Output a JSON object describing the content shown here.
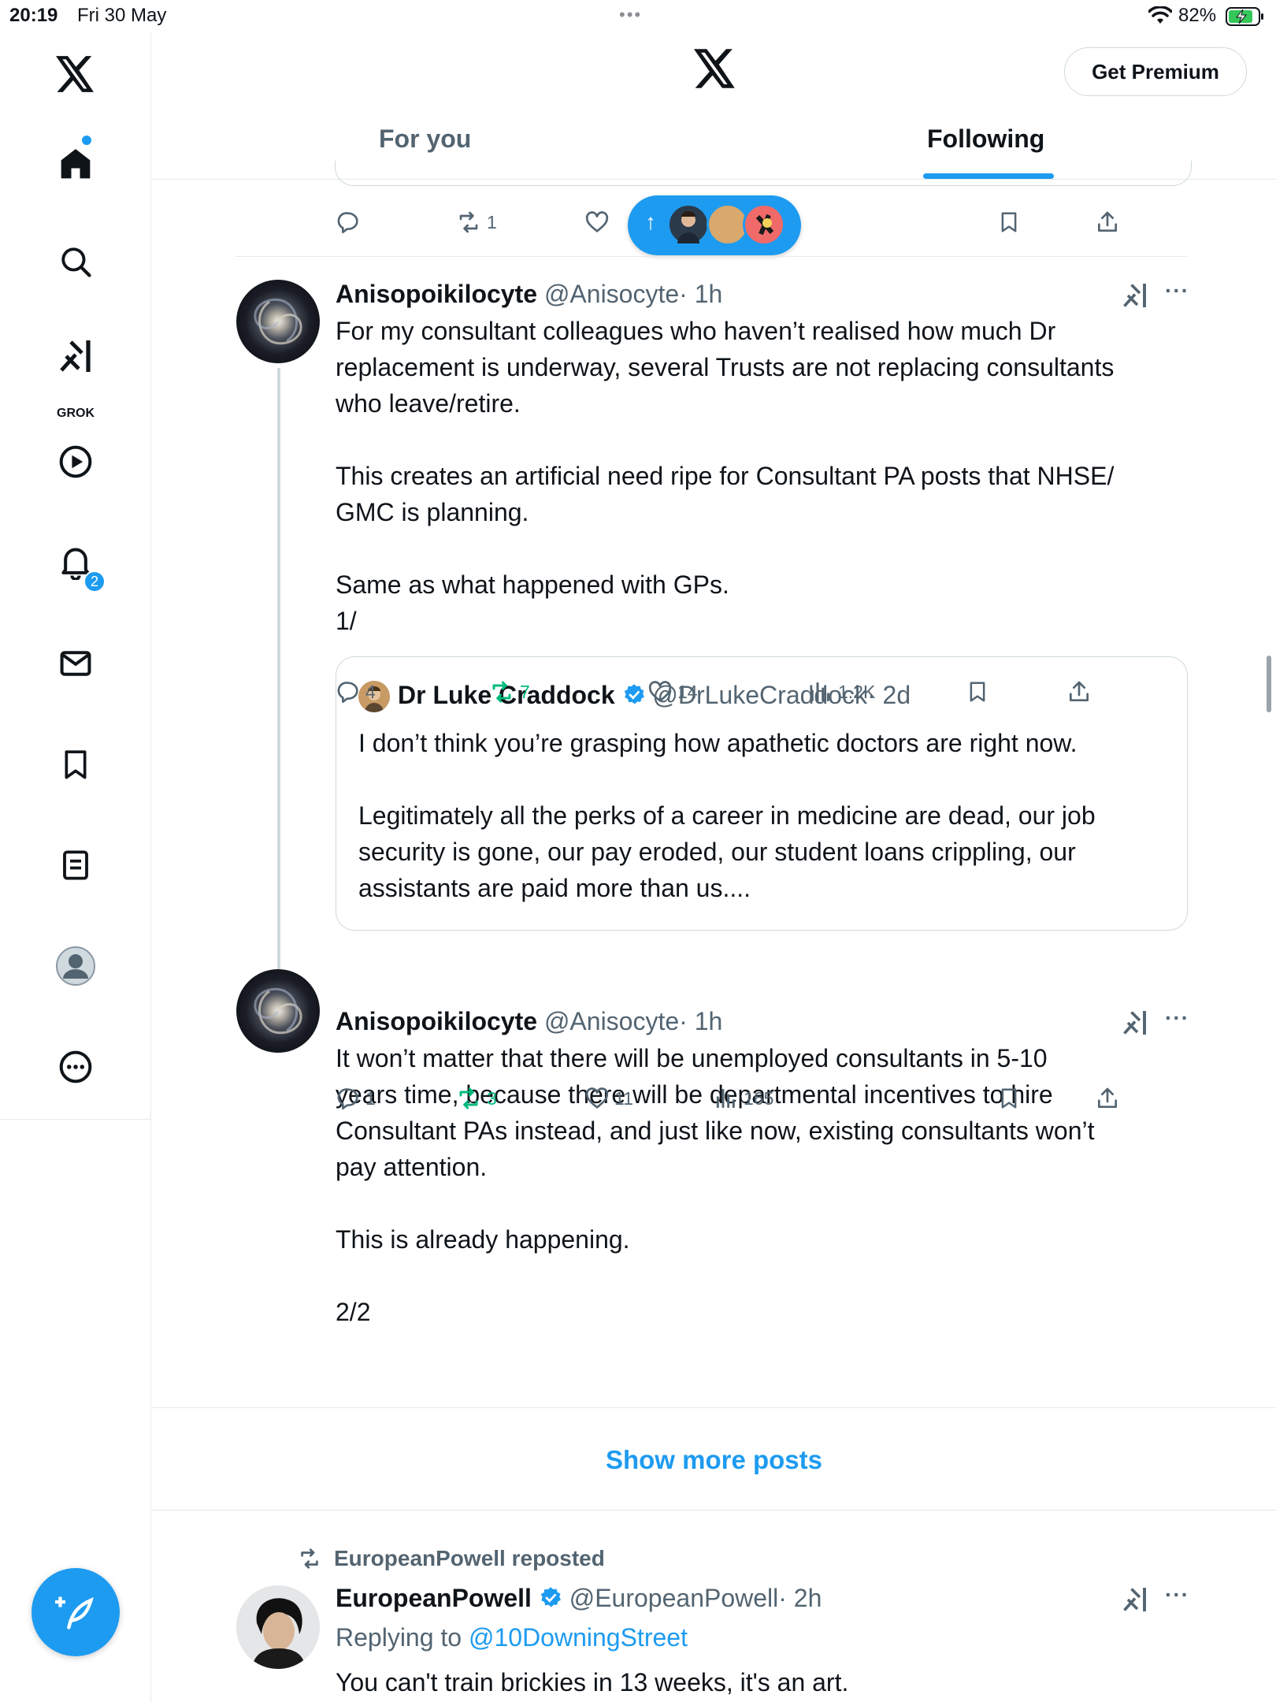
{
  "status_bar": {
    "time": "20:19",
    "date": "Fri 30 May",
    "battery": "82%"
  },
  "header": {
    "premium": "Get Premium",
    "tabs": [
      "For you",
      "Following"
    ]
  },
  "sidebar": {
    "grok_label": "GROK",
    "notifications_count": "2"
  },
  "top_post_actions": {
    "reposts": "1"
  },
  "post1": {
    "name": "Anisopoikilocyte",
    "handle": "@Anisocyte",
    "time": "· 1h",
    "text": "For my consultant colleagues who haven’t realised how much Dr\nreplacement is underway, several Trusts are not replacing consultants\nwho leave/retire.\n\nThis creates an artificial need ripe for Consultant PA posts that NHSE/\nGMC is planning.\n\nSame as what happened with GPs.\n1/",
    "quote": {
      "name": "Dr Luke Craddock",
      "handle": "@DrLukeCraddock",
      "time": "· 2d",
      "text": "I don’t think you’re grasping how apathetic doctors are right now.\n\nLegitimately all the perks of a career in medicine are dead, our job\nsecurity is gone, our pay eroded, our student loans crippling, our\nassistants are paid more than us...."
    },
    "replies": "4",
    "reposts": "7",
    "likes": "14",
    "views": "1.2K"
  },
  "post2": {
    "name": "Anisopoikilocyte",
    "handle": "@Anisocyte",
    "time": "· 1h",
    "text": "It won’t matter that there will be unemployed consultants in 5-10\nyears time, because there will be departmental incentives to hire\nConsultant PAs instead, and just like now, existing consultants won’t\npay attention.\n\nThis is already happening.\n\n2/2",
    "replies": "1",
    "reposts": "3",
    "likes": "11",
    "views": "165"
  },
  "show_more": "Show more posts",
  "post3": {
    "reposted_by": "EuropeanPowell reposted",
    "name": "EuropeanPowell",
    "handle": "@EuropeanPowell",
    "time": "· 2h",
    "replying_prefix": "Replying to ",
    "replying_to": "@10DowningStreet",
    "text": "You can't train brickies in 13 weeks, it's an art."
  }
}
